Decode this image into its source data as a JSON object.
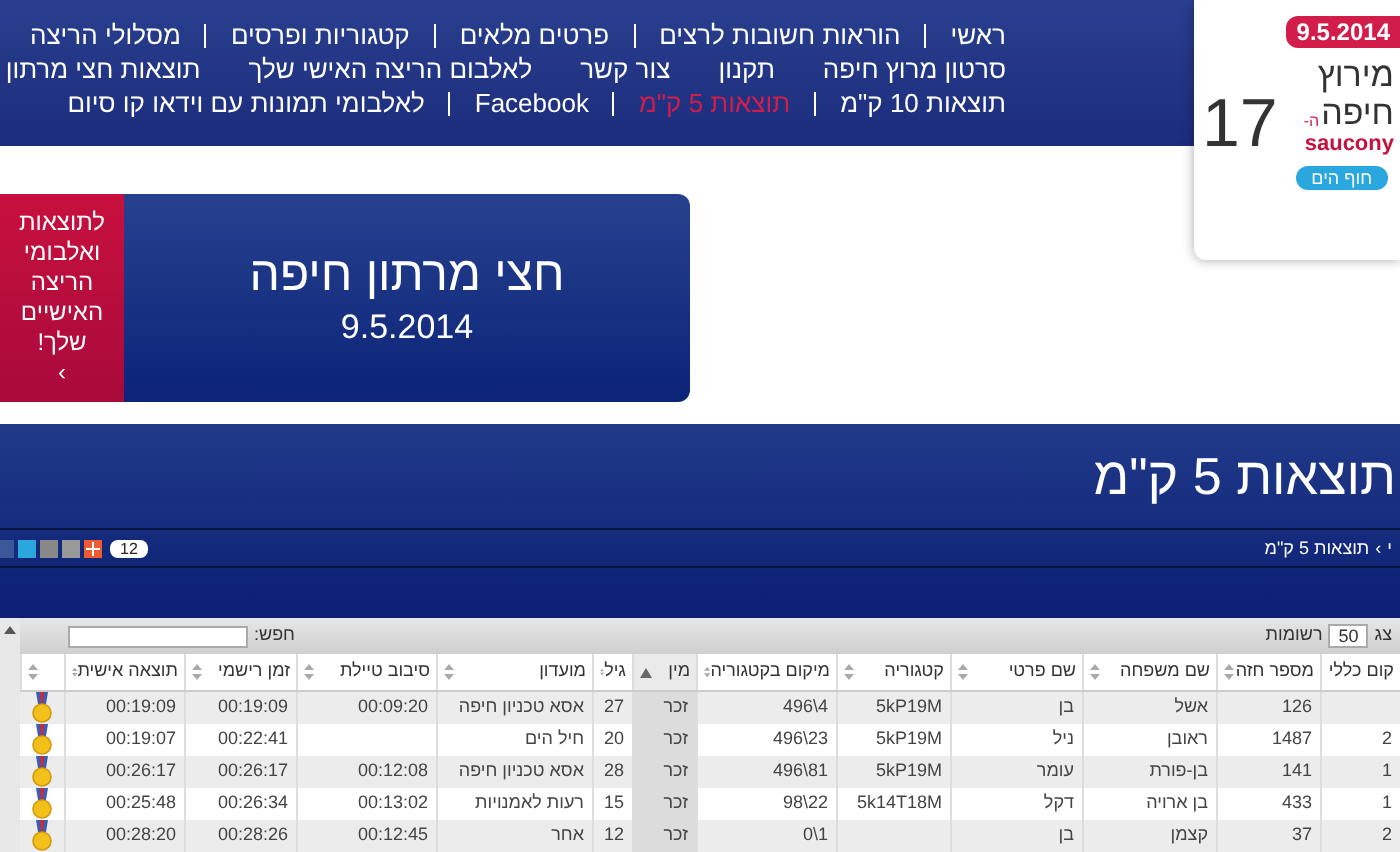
{
  "nav": {
    "rows": [
      [
        {
          "label": "ראשי",
          "selected": false
        },
        {
          "label": "הוראות חשובות לרצים",
          "selected": false
        },
        {
          "label": "פרטים מלאים",
          "selected": false
        },
        {
          "label": "קטגוריות ופרסים",
          "selected": false
        },
        {
          "label": "מסלולי הריצה",
          "selected": false
        }
      ],
      [
        {
          "label": "סרטון מרוץ חיפה",
          "selected": false
        },
        {
          "label": "תקנון",
          "selected": false
        },
        {
          "label": "צור קשר",
          "selected": false
        },
        {
          "label": "לאלבום הריצה האישי שלך",
          "selected": false
        },
        {
          "label": "תוצאות חצי מרתון",
          "selected": false
        }
      ],
      [
        {
          "label": "תוצאות 10 ק\"מ",
          "selected": false
        },
        {
          "label": "תוצאות 5 ק\"מ",
          "selected": true
        },
        {
          "label": "Facebook",
          "selected": false
        },
        {
          "label": "לאלבומי תמונות עם וידאו קו סיום",
          "selected": false
        }
      ]
    ]
  },
  "logo": {
    "date": "9.5.2014",
    "line_1": "מירוץ",
    "line_2": "חיפה",
    "prefix": "ה-",
    "number": "17",
    "sponsor": "saucony",
    "beach": "חוף הים"
  },
  "promo": {
    "text": "לתוצאות ואלבומי הריצה האישיים שלך!",
    "arrow": "›"
  },
  "event": {
    "title": "חצי מרתון חיפה",
    "date": "9.5.2014"
  },
  "page_title": "תוצאות 5 ק\"מ",
  "breadcrumb": [
    "י",
    "תוצאות 5 ק\"מ"
  ],
  "share": {
    "count": "12"
  },
  "table_controls": {
    "show_label": "צג",
    "page_size": "50",
    "records_label": "רשומות",
    "search_label": "חפש:"
  },
  "table": {
    "columns": [
      {
        "label": "קום כללי",
        "sorted": false
      },
      {
        "label": "מספר חזה",
        "sorted": false
      },
      {
        "label": "שם משפחה",
        "sorted": false
      },
      {
        "label": "שם פרטי",
        "sorted": false
      },
      {
        "label": "קטגוריה",
        "sorted": false
      },
      {
        "label": "מיקום בקטגוריה",
        "sorted": false
      },
      {
        "label": "מין",
        "sorted": true
      },
      {
        "label": "גיל",
        "sorted": false
      },
      {
        "label": "מועדון",
        "sorted": false
      },
      {
        "label": "סיבוב טיילת",
        "sorted": false
      },
      {
        "label": "זמן רישמי",
        "sorted": false
      },
      {
        "label": "תוצאה אישית",
        "sorted": false
      },
      {
        "sorted": false
      }
    ],
    "rows": [
      {
        "cells": [
          null,
          "126",
          "אשל",
          "בן",
          "5kP19M",
          "496\\4",
          "זכר",
          "27",
          "אסא טכניון חיפה",
          "00:09:20",
          "00:19:09",
          "00:19:09"
        ],
        "medal": true
      },
      {
        "cells": [
          "2",
          "1487",
          "ראובן",
          "ניל",
          "5kP19M",
          "496\\23",
          "זכר",
          "20",
          "חיל הים",
          null,
          "00:22:41",
          "00:19:07"
        ],
        "medal": true
      },
      {
        "cells": [
          "1",
          "141",
          "בן-פורת",
          "עומר",
          "5kP19M",
          "496\\81",
          "זכר",
          "28",
          "אסא טכניון חיפה",
          "00:12:08",
          "00:26:17",
          "00:26:17"
        ],
        "medal": true
      },
      {
        "cells": [
          "1",
          "433",
          "בן ארויה",
          "דקל",
          "5k14T18M",
          "98\\22",
          "זכר",
          "15",
          "רעות לאמנויות",
          "00:13:02",
          "00:26:34",
          "00:25:48"
        ],
        "medal": true
      },
      {
        "cells": [
          "2",
          "37",
          "קצמן",
          "בן",
          null,
          "0\\1",
          "זכר",
          "12",
          "אחר",
          "00:12:45",
          "00:28:26",
          "00:28:20"
        ],
        "medal": true
      }
    ]
  }
}
